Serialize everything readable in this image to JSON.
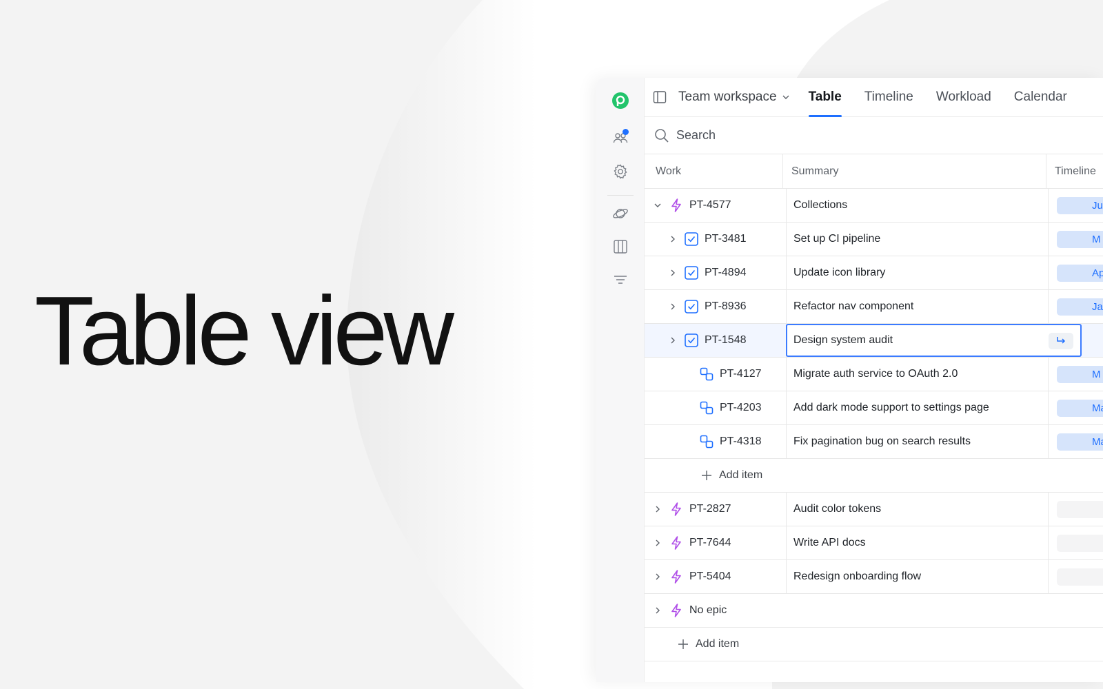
{
  "hero": {
    "title": "Table view"
  },
  "colors": {
    "accent": "#1e6fff",
    "epic": "#b04fe8",
    "logo": "#22c46b",
    "pill_bg": "#d6e4fb"
  },
  "rail": {
    "items": [
      {
        "icon": "logo-icon"
      },
      {
        "icon": "people-icon",
        "notification": true
      },
      {
        "icon": "gear-icon"
      },
      {
        "icon": "planet-icon"
      },
      {
        "icon": "columns-icon"
      },
      {
        "icon": "filter-icon"
      }
    ]
  },
  "header": {
    "workspace": "Team workspace",
    "tabs": [
      {
        "label": "Table",
        "active": true
      },
      {
        "label": "Timeline",
        "active": false
      },
      {
        "label": "Workload",
        "active": false
      },
      {
        "label": "Calendar",
        "active": false
      }
    ]
  },
  "search": {
    "placeholder": "Search"
  },
  "table": {
    "columns": {
      "work": "Work",
      "summary": "Summary",
      "timeline": "Timeline"
    },
    "rows": [
      {
        "key": "PT-4577",
        "summary": "Collections",
        "type": "epic",
        "level": 0,
        "chevron": "down",
        "timeline": "Ju"
      },
      {
        "key": "PT-3481",
        "summary": "Set up CI pipeline",
        "type": "task",
        "level": 1,
        "chevron": "right",
        "timeline": "M"
      },
      {
        "key": "PT-4894",
        "summary": "Update icon library",
        "type": "task",
        "level": 1,
        "chevron": "right",
        "timeline": "Ap"
      },
      {
        "key": "PT-8936",
        "summary": "Refactor nav component",
        "type": "task",
        "level": 1,
        "chevron": "right",
        "timeline": "Ja"
      },
      {
        "key": "PT-1548",
        "summary": "Design system audit",
        "type": "task",
        "level": 1,
        "chevron": "right",
        "timeline": "",
        "editing": true
      },
      {
        "key": "PT-4127",
        "summary": "Migrate auth service to OAuth 2.0",
        "type": "subtask",
        "level": 2,
        "chevron": "none",
        "timeline": "M"
      },
      {
        "key": "PT-4203",
        "summary": "Add dark mode support to settings page",
        "type": "subtask",
        "level": 2,
        "chevron": "none",
        "timeline": "Ma"
      },
      {
        "key": "PT-4318",
        "summary": "Fix pagination bug on search results",
        "type": "subtask",
        "level": 2,
        "chevron": "none",
        "timeline": "Ma"
      },
      {
        "add_item": "Add item",
        "level": 2
      },
      {
        "key": "PT-2827",
        "summary": "Audit color tokens",
        "type": "epic",
        "level": 0,
        "chevron": "right",
        "timeline": "",
        "empty_pill": true
      },
      {
        "key": "PT-7644",
        "summary": "Write API docs",
        "type": "epic",
        "level": 0,
        "chevron": "right",
        "timeline": "",
        "empty_pill": true
      },
      {
        "key": "PT-5404",
        "summary": "Redesign onboarding flow",
        "type": "epic",
        "level": 0,
        "chevron": "right",
        "timeline": "",
        "empty_pill": true
      },
      {
        "key": "No epic",
        "summary": "",
        "type": "epic",
        "level": 0,
        "chevron": "right",
        "timeline": "",
        "no_cols": true
      },
      {
        "add_item": "Add item",
        "level": 0
      }
    ]
  }
}
